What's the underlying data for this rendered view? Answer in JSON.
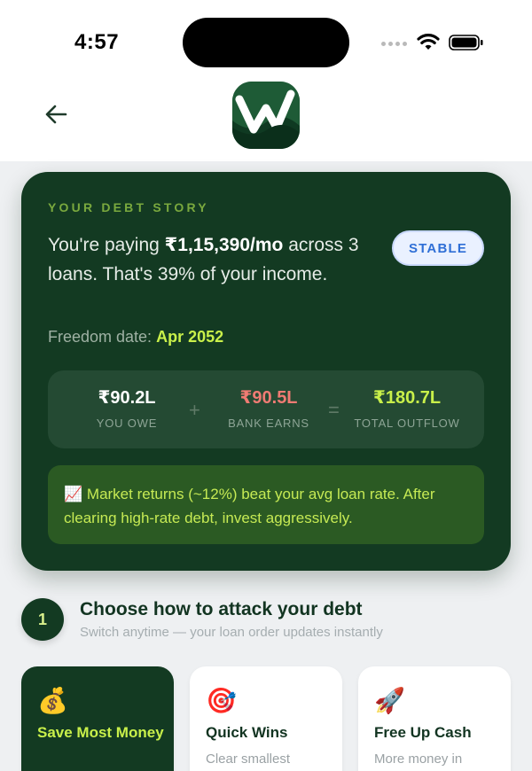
{
  "status": {
    "time": "4:57"
  },
  "debt_story": {
    "eyebrow": "YOUR DEBT STORY",
    "summary_prefix": "You're paying ",
    "monthly_amount": "₹1,15,390/mo",
    "summary_suffix": " across 3 loans. That's 39% of your income.",
    "status_badge": "STABLE",
    "freedom_label": "Freedom date:",
    "freedom_date": "Apr 2052",
    "stats": [
      {
        "value": "₹90.2L",
        "label": "YOU OWE",
        "color": "#ffffff"
      },
      {
        "value": "₹90.5L",
        "label": "BANK EARNS",
        "color": "#f07b73"
      },
      {
        "value": "₹180.7L",
        "label": "TOTAL OUTFLOW",
        "color": "#c9f04a"
      }
    ],
    "operator_plus": "+",
    "operator_equals": "=",
    "tip_icon": "📈",
    "tip_text": "Market returns (~12%) beat your avg loan rate. After clearing high-rate debt, invest aggressively."
  },
  "step": {
    "number": "1",
    "title": "Choose how to attack your debt",
    "subtitle": "Switch anytime — your loan order updates instantly"
  },
  "strategies": [
    {
      "icon": "💰",
      "icon_name": "money-bag-icon",
      "title": "Save Most Money",
      "desc": "",
      "active": true
    },
    {
      "icon": "🎯",
      "icon_name": "target-icon",
      "title": "Quick Wins",
      "desc": "Clear smallest",
      "active": false
    },
    {
      "icon": "🚀",
      "icon_name": "rocket-icon",
      "title": "Free Up Cash",
      "desc": "More money in",
      "active": false
    }
  ],
  "colors": {
    "card": "#133a22",
    "accent": "#c9f04a",
    "badge": "#2f6fd6"
  }
}
